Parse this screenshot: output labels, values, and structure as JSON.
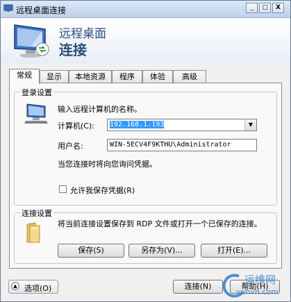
{
  "window": {
    "title": "远程桌面连接",
    "controls": {
      "minimize": "_",
      "maximize": "□",
      "close": "X"
    }
  },
  "header": {
    "subtitle": "远程桌面",
    "title": "连接"
  },
  "tabs": [
    {
      "label": "常规",
      "active": true
    },
    {
      "label": "显示",
      "active": false
    },
    {
      "label": "本地资源",
      "active": false
    },
    {
      "label": "程序",
      "active": false
    },
    {
      "label": "体验",
      "active": false
    },
    {
      "label": "高级",
      "active": false
    }
  ],
  "login": {
    "legend": "登录设置",
    "instruction": "输入远程计算机的名称。",
    "computer_label": "计算机(C):",
    "computer_value": "192.168.1.193",
    "username_label": "用户名:",
    "username_value": "WIN-5ECV4F9KTHU\\Administrator",
    "credentials_note": "当您连接时将向您询问凭据。",
    "save_credentials_label": "允许我保存凭据(R)",
    "save_credentials_checked": false
  },
  "connection": {
    "legend": "连接设置",
    "description": "将当前连接设置保存到 RDP 文件或打开一个已保存的连接。",
    "save_label": "保存(S)",
    "save_as_label": "另存为(V)...",
    "open_label": "打开(E)..."
  },
  "footer": {
    "options_label": "选项(O)",
    "connect_label": "连接(N)",
    "help_label": "帮助(H)"
  },
  "watermark": {
    "line1": "运维网",
    "line2": "yunvn.com"
  },
  "colors": {
    "accent": "#2b4c7e",
    "selection": "#3399ff",
    "watermark": "#4a8fd0"
  }
}
